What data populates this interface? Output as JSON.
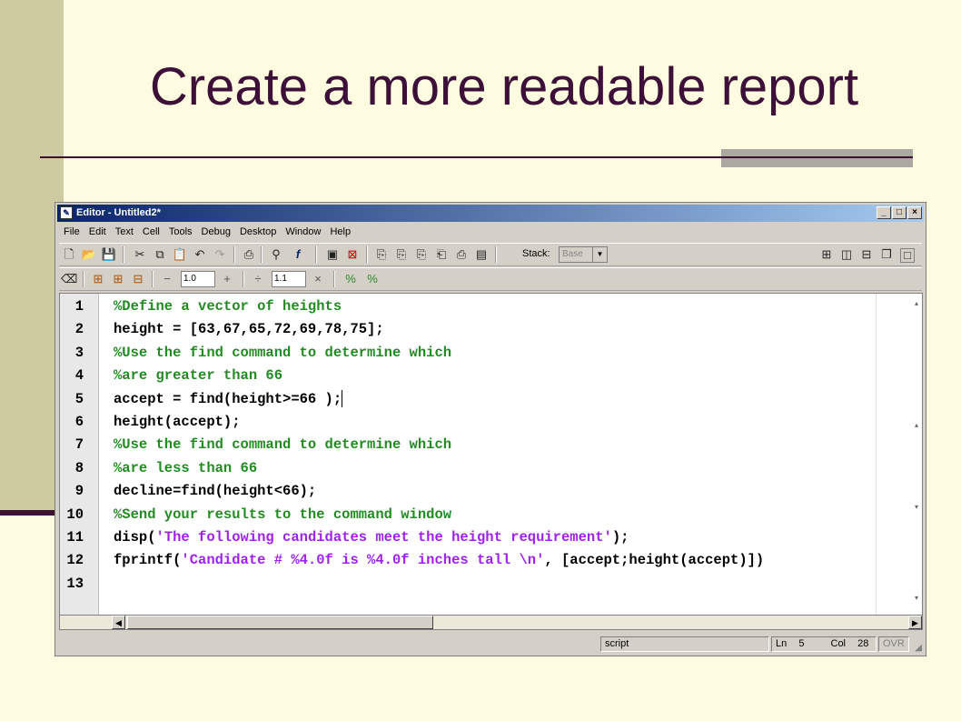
{
  "slide": {
    "title": "Create a more readable report"
  },
  "window": {
    "title": "Editor - Untitled2*",
    "app_icon": "matlab-editor-icon",
    "buttons": [
      "_",
      "□",
      "×"
    ]
  },
  "menu": [
    {
      "label": "File"
    },
    {
      "label": "Edit"
    },
    {
      "label": "Text"
    },
    {
      "label": "Cell"
    },
    {
      "label": "Tools"
    },
    {
      "label": "Debug"
    },
    {
      "label": "Desktop"
    },
    {
      "label": "Window"
    },
    {
      "label": "Help"
    }
  ],
  "toolbar": {
    "stack_label": "Stack:",
    "stack_value": "Base",
    "cell_minus": "−",
    "cell_value_1": "1.0",
    "cell_plus": "+",
    "cell_div": "÷",
    "cell_value_2": "1.1",
    "cell_times": "×"
  },
  "code": {
    "lines": [
      {
        "num": "1",
        "segments": [
          {
            "type": "comment",
            "text": "%Define a vector of heights"
          }
        ]
      },
      {
        "num": "2",
        "segments": [
          {
            "type": "code",
            "text": "height = [63,67,65,72,69,78,75];"
          }
        ]
      },
      {
        "num": "3",
        "segments": [
          {
            "type": "comment",
            "text": "%Use the find command to determine which"
          }
        ]
      },
      {
        "num": "4",
        "segments": [
          {
            "type": "comment",
            "text": "%are greater than 66"
          }
        ]
      },
      {
        "num": "5",
        "segments": [
          {
            "type": "code",
            "text": "accept = find(height>=66 );"
          }
        ]
      },
      {
        "num": "6",
        "segments": [
          {
            "type": "code",
            "text": "height(accept);"
          }
        ]
      },
      {
        "num": "7",
        "segments": [
          {
            "type": "comment",
            "text": "%Use the find command to determine which"
          }
        ]
      },
      {
        "num": "8",
        "segments": [
          {
            "type": "comment",
            "text": "%are less than 66"
          }
        ]
      },
      {
        "num": "9",
        "segments": [
          {
            "type": "code",
            "text": "decline=find(height<66);"
          }
        ]
      },
      {
        "num": "10",
        "segments": [
          {
            "type": "comment",
            "text": "%Send your results to the command window"
          }
        ]
      },
      {
        "num": "11",
        "segments": [
          {
            "type": "code",
            "text": "disp("
          },
          {
            "type": "string",
            "text": "'The following candidates meet the height requirement'"
          },
          {
            "type": "code",
            "text": ");"
          }
        ]
      },
      {
        "num": "12",
        "segments": [
          {
            "type": "code",
            "text": "fprintf("
          },
          {
            "type": "string",
            "text": "'Candidate # %4.0f is %4.0f inches tall \\n'"
          },
          {
            "type": "code",
            "text": ", [accept;height(accept)])"
          }
        ]
      },
      {
        "num": "13",
        "segments": []
      }
    ]
  },
  "status": {
    "mode": "script",
    "ln_label": "Ln",
    "ln_value": "5",
    "col_label": "Col",
    "col_value": "28",
    "ovr": "OVR"
  },
  "colors": {
    "comment": "#228b22",
    "string": "#a020f0",
    "title": "#3c1038",
    "titlebar": "#0a246a"
  }
}
